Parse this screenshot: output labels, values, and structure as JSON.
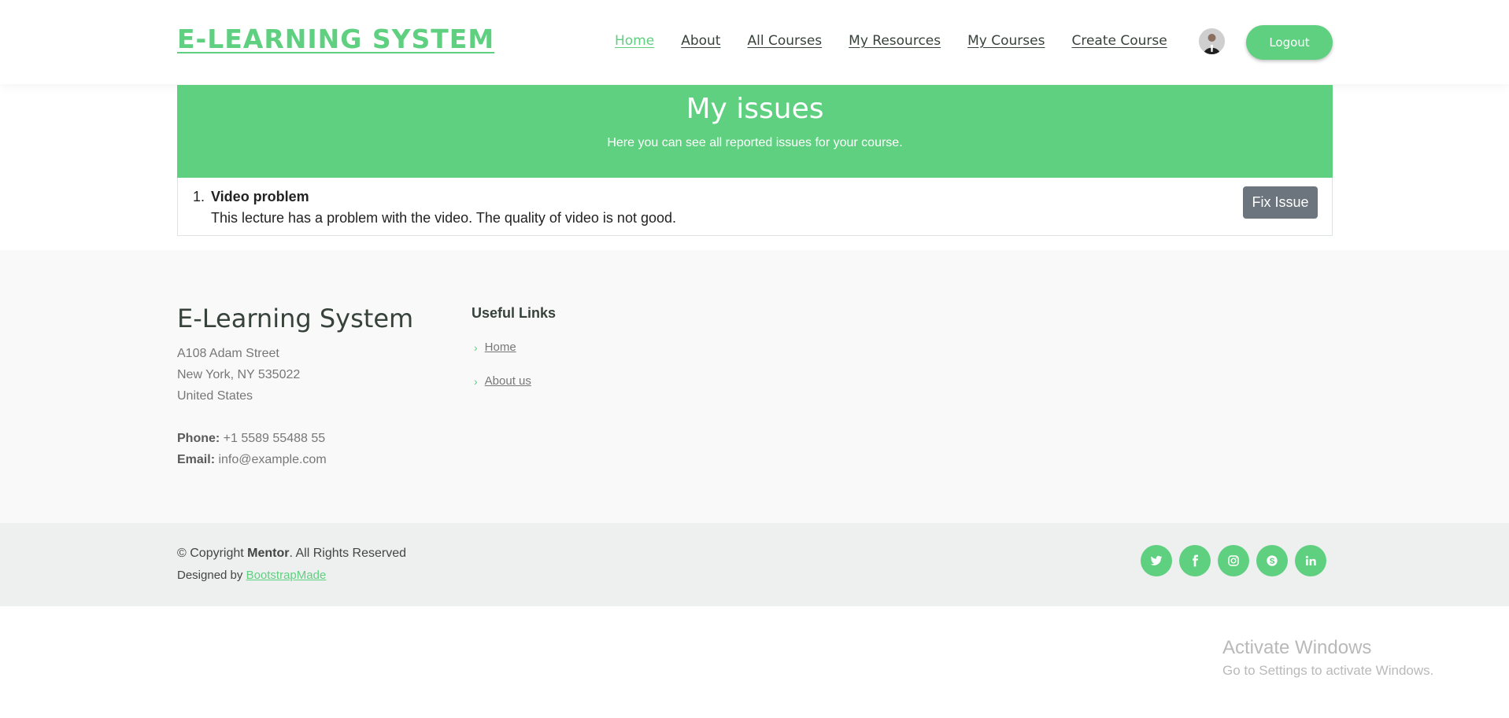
{
  "header": {
    "logo": "E-LEARNING SYSTEM",
    "nav": [
      "Home",
      "About",
      "All Courses",
      "My Resources",
      "My Courses",
      "Create Course"
    ],
    "active_nav": "Home",
    "logout_label": "Logout"
  },
  "banner": {
    "title": "My issues",
    "subtitle": "Here you can see all reported issues for your course."
  },
  "issues": [
    {
      "number": "1.",
      "title": "Video problem",
      "description": "This lecture has a problem with the video. The quality of video is not good.",
      "action_label": "Fix Issue"
    }
  ],
  "footer": {
    "brand": "E-Learning System",
    "address": [
      "A108 Adam Street",
      "New York, NY 535022",
      "United States"
    ],
    "phone_label": "Phone:",
    "phone": "+1 5589 55488 55",
    "email_label": "Email:",
    "email": "info@example.com",
    "links_title": "Useful Links",
    "links": [
      "Home",
      "About us"
    ]
  },
  "copyright": {
    "prefix": "© Copyright",
    "name": "Mentor",
    "suffix": ". All Rights Reserved",
    "designed_by": "Designed by",
    "designer": "BootstrapMade"
  },
  "socials": [
    "twitter-icon",
    "facebook-icon",
    "instagram-icon",
    "skype-icon",
    "linkedin-icon"
  ],
  "watermark": {
    "title": "Activate Windows",
    "subtitle": "Go to Settings to activate Windows."
  },
  "colors": {
    "accent": "#5fcf80",
    "button_gray": "#6c757d"
  }
}
